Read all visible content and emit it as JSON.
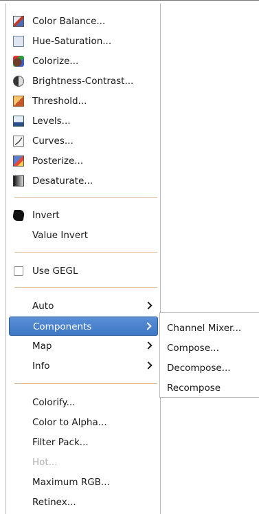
{
  "menu": {
    "items": [
      {
        "label": "Color Balance..."
      },
      {
        "label": "Hue-Saturation..."
      },
      {
        "label": "Colorize..."
      },
      {
        "label": "Brightness-Contrast..."
      },
      {
        "label": "Threshold..."
      },
      {
        "label": "Levels..."
      },
      {
        "label": "Curves..."
      },
      {
        "label": "Posterize..."
      },
      {
        "label": "Desaturate..."
      },
      {
        "label": "Invert"
      },
      {
        "label": "Value Invert"
      },
      {
        "label": "Use GEGL",
        "checked": false
      },
      {
        "label": "Auto"
      },
      {
        "label": "Components",
        "selected": true
      },
      {
        "label": "Map"
      },
      {
        "label": "Info"
      },
      {
        "label": "Colorify..."
      },
      {
        "label": "Color to Alpha..."
      },
      {
        "label": "Filter Pack..."
      },
      {
        "label": "Hot...",
        "disabled": true
      },
      {
        "label": "Maximum RGB..."
      },
      {
        "label": "Retinex..."
      }
    ]
  },
  "submenu": {
    "items": [
      {
        "label": "Channel Mixer..."
      },
      {
        "label": "Compose..."
      },
      {
        "label": "Decompose..."
      },
      {
        "label": "Recompose"
      }
    ]
  },
  "colors": {
    "selection": "#4a82cc",
    "separator": "#d8b58a",
    "disabled_text": "#b0b0b0"
  }
}
